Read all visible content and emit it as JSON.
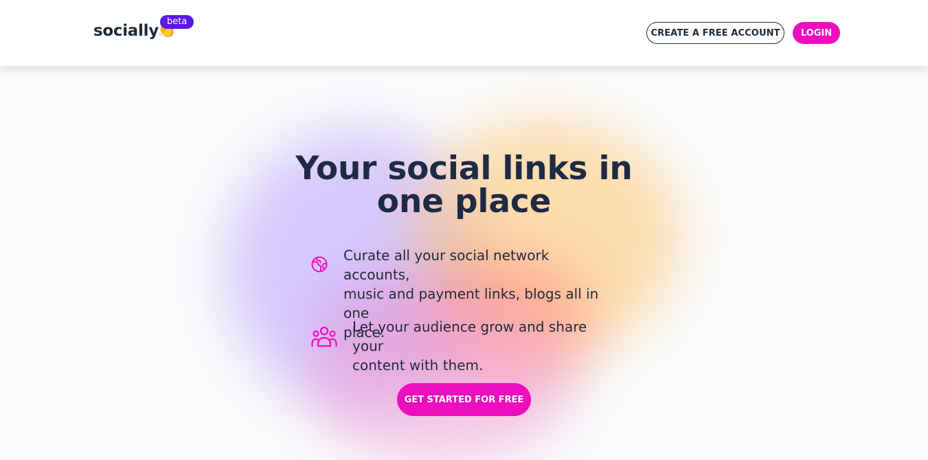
{
  "header": {
    "logo_text": "socially",
    "logo_emoji": "👏",
    "beta_badge": "beta",
    "create_account_label": "CREATE A FREE ACCOUNT",
    "login_label": "LOGIN"
  },
  "hero": {
    "title_line1": "Your social links in",
    "title_line2": "one place",
    "features": [
      {
        "icon": "globe-icon",
        "text_line1": "Curate all your social network accounts,",
        "text_line2": "music and payment links, blogs all in one",
        "text_line3": "place."
      },
      {
        "icon": "users-group-icon",
        "text_line1": "Let your audience grow and share your",
        "text_line2": "content with them."
      }
    ],
    "cta_label": "GET STARTED FOR FREE"
  },
  "colors": {
    "accent": "#ec0fc0",
    "beta": "#5b16e8",
    "text": "#1f2937"
  }
}
